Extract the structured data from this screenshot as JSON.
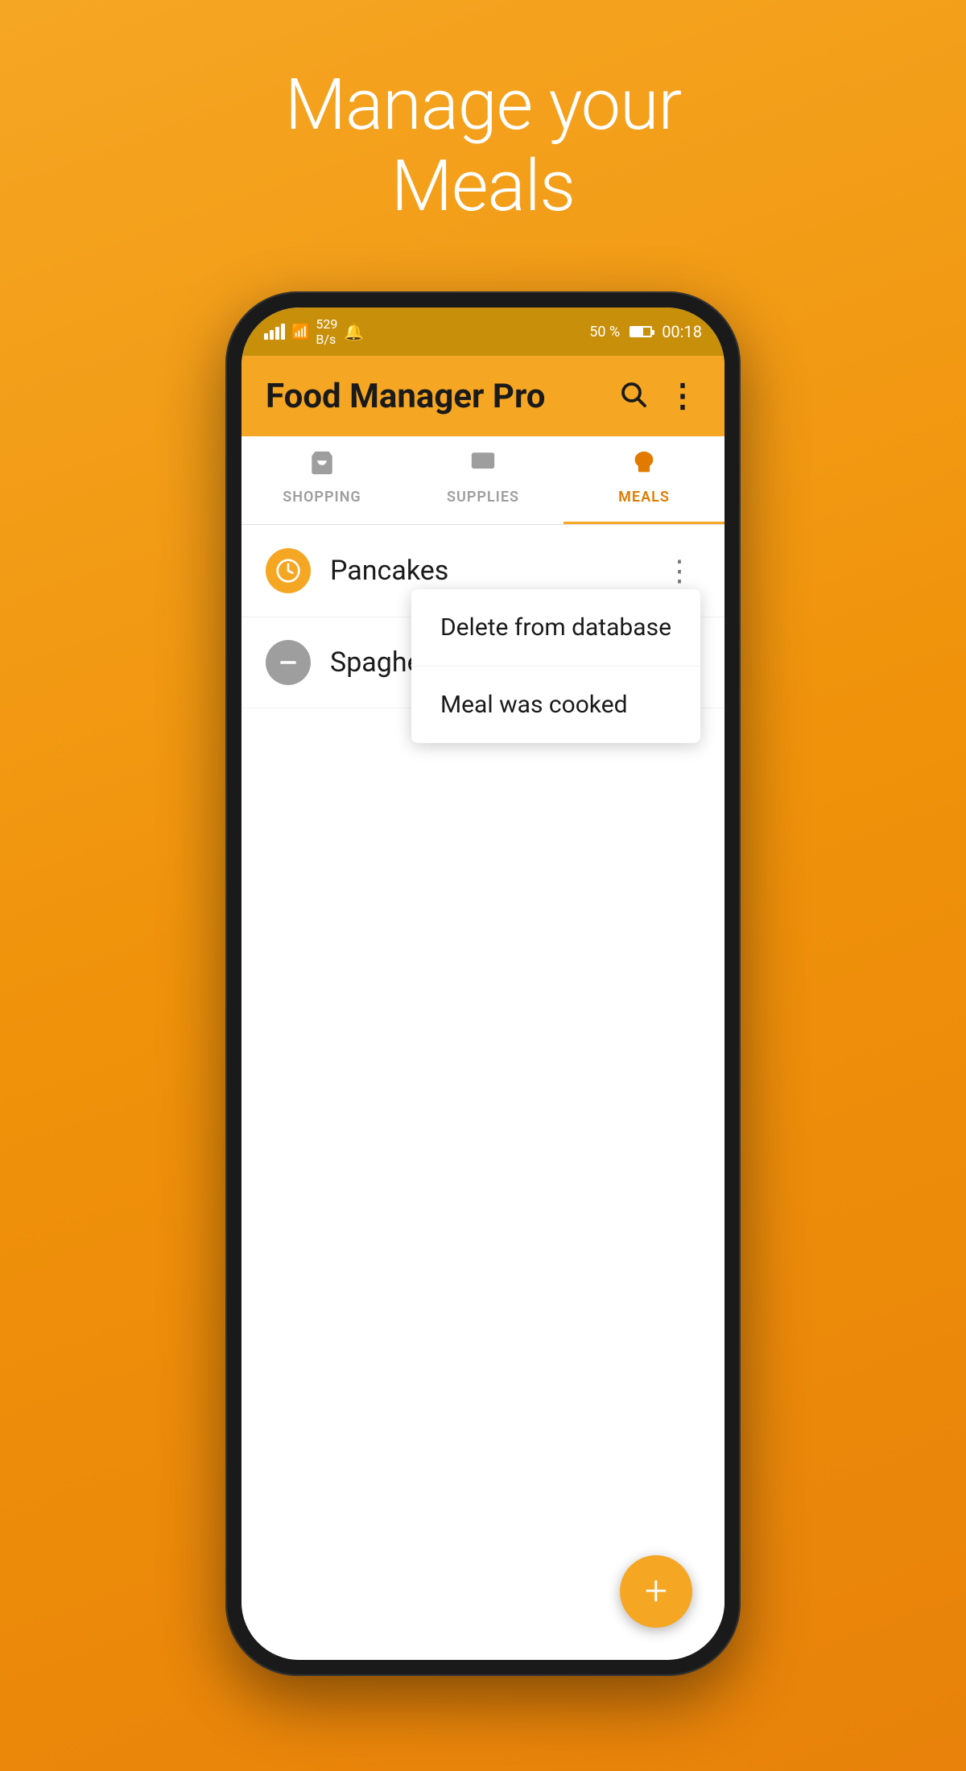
{
  "hero": {
    "title": "Manage your\nMeals"
  },
  "status_bar": {
    "speed": "529\nB/s",
    "battery_percent": "50 %",
    "time": "00:18"
  },
  "app_bar": {
    "title": "Food Manager Pro",
    "search_label": "search",
    "more_label": "more"
  },
  "tabs": [
    {
      "id": "shopping",
      "label": "SHOPPING",
      "icon": "🛒",
      "active": false
    },
    {
      "id": "supplies",
      "label": "SUPPLIES",
      "icon": "🏪",
      "active": false
    },
    {
      "id": "meals",
      "label": "MEALS",
      "icon": "🍕",
      "active": true
    }
  ],
  "meals": [
    {
      "id": "pancakes",
      "name": "Pancakes",
      "icon": "clock",
      "icon_color": "orange"
    },
    {
      "id": "spaghetti",
      "name": "Spaghetti Bolog…",
      "icon": "minus",
      "icon_color": "grey"
    }
  ],
  "context_menu": {
    "items": [
      {
        "id": "delete",
        "label": "Delete from database"
      },
      {
        "id": "cooked",
        "label": "Meal was cooked"
      }
    ]
  },
  "fab": {
    "label": "+"
  }
}
